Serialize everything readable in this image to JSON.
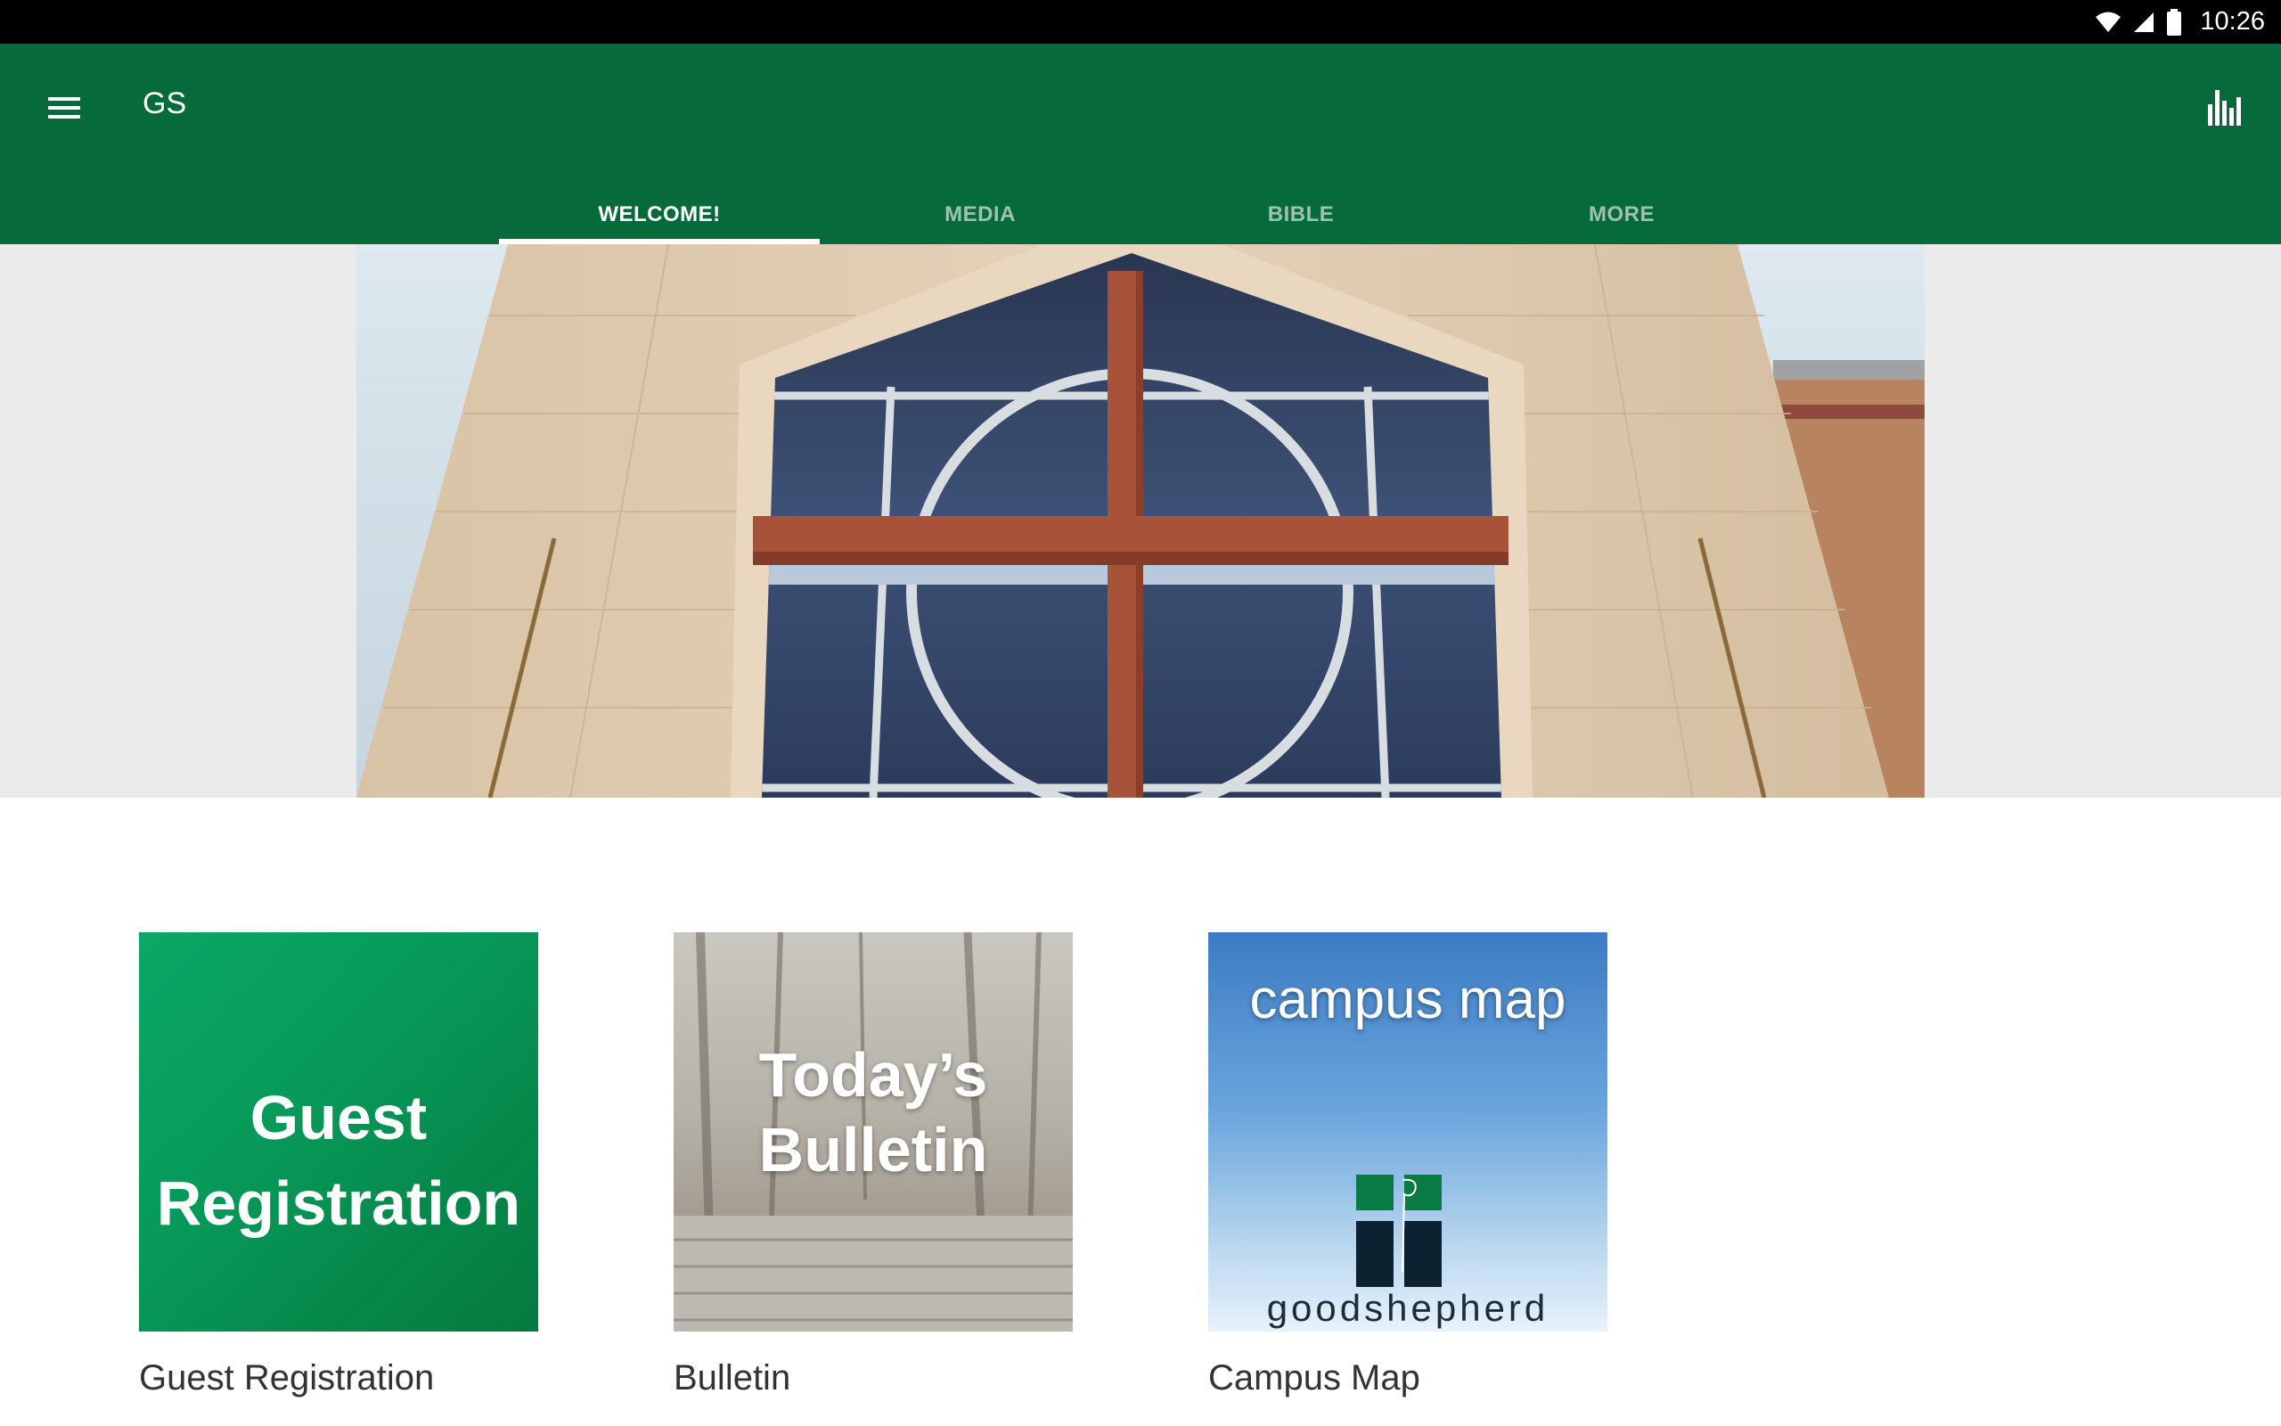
{
  "status_bar": {
    "time": "10:26"
  },
  "app_bar": {
    "title": "GS",
    "color": "#066a3a",
    "menu_icon": "hamburger-menu-icon",
    "action_icon": "bar-chart-icon"
  },
  "tabs": [
    {
      "label": "WELCOME!",
      "active": true
    },
    {
      "label": "MEDIA",
      "active": false
    },
    {
      "label": "BIBLE",
      "active": false
    },
    {
      "label": "MORE",
      "active": false
    }
  ],
  "tiles": [
    {
      "image_text_line1": "Guest",
      "image_text_line2": "Registration",
      "caption": "Guest Registration"
    },
    {
      "image_text_line1": "Today’s",
      "image_text_line2": "Bulletin",
      "caption": "Bulletin"
    },
    {
      "image_heading": "campus map",
      "image_brand_a": "good",
      "image_brand_b": "shepherd",
      "caption": "Campus Map"
    }
  ]
}
